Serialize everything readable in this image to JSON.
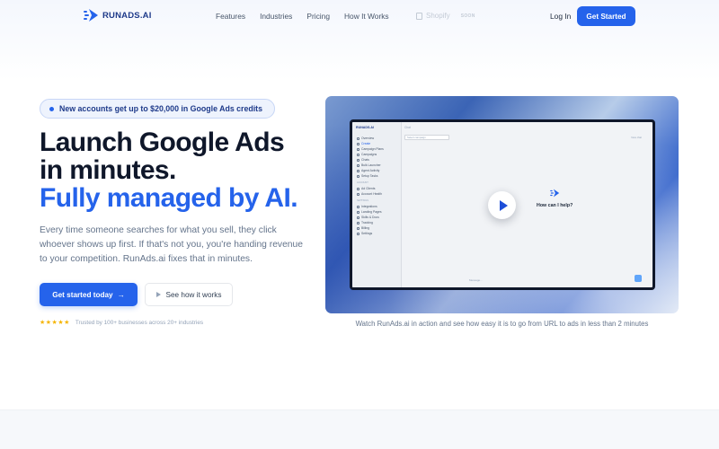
{
  "nav": {
    "brand": "RUNADS.AI",
    "links": [
      "Features",
      "Industries",
      "Pricing",
      "How It Works"
    ],
    "shopify": {
      "name": "Shopify",
      "tag": "SOON"
    },
    "login": "Log In",
    "cta": "Get Started"
  },
  "hero": {
    "badge": "New accounts get up to $20,000 in Google Ads credits",
    "title_line1": "Launch Google Ads",
    "title_line2": "in minutes.",
    "title_line3": "Fully managed by AI.",
    "description": "Every time someone searches for what you sell, they click whoever shows up first. If that's not you, you're handing revenue to your competition. RunAds.ai fixes that in minutes.",
    "primary_cta": "Get started today",
    "secondary_cta": "See how it works",
    "stars": "★★★★★",
    "trust": "Trusted by 100+ businesses across 20+ industries"
  },
  "video": {
    "caption": "Watch RunAds.ai in action and see how easy it is to go from URL to ads in less than 2 minutes",
    "screen": {
      "brand": "RUNADS.AI",
      "nav_items": [
        "Overview",
        "Create",
        "Campaign Plans",
        "Campaigns",
        "Chats",
        "Bulk Launcher",
        "Agent Activity",
        "Setup Tasks"
      ],
      "section_label": "ACCOUNT",
      "account_items": [
        "Ad Clients",
        "Account Health"
      ],
      "section_label2": "SETTINGS",
      "settings_items": [
        "Integrations",
        "Landing Pages",
        "Skills & Docs",
        "Tracking",
        "Billing",
        "Settings"
      ],
      "top_label": "Chat",
      "select_label": "Select campaign",
      "right_label": "New chat",
      "help_text": "How can I help?",
      "input_placeholder": "Message..."
    }
  },
  "colors": {
    "accent": "#2563eb",
    "brand_dark": "#1e3a8a",
    "star": "#f5b400"
  }
}
